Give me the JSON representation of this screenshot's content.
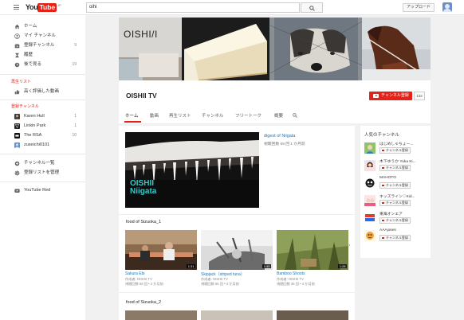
{
  "header": {
    "logo_you": "You",
    "logo_tube": "Tube",
    "logo_region": "JP",
    "search_value": "oihi",
    "upload_label": "アップロード"
  },
  "sidebar": {
    "nav": [
      {
        "label": "ホーム",
        "icon": "home-icon"
      },
      {
        "label": "マイ チャンネル",
        "icon": "person-icon"
      },
      {
        "label": "登録チャンネル",
        "icon": "subscriptions-icon",
        "count": "9"
      },
      {
        "label": "履歴",
        "icon": "hourglass-icon"
      },
      {
        "label": "後で見る",
        "icon": "clock-icon",
        "count": "19"
      }
    ],
    "playlists_heading": "再生リスト",
    "playlists": [
      {
        "label": "高く評価した動画",
        "icon": "thumbs-up-icon"
      }
    ],
    "subscriptions_heading": "登録チャンネル",
    "subscriptions": [
      {
        "label": "Karen Hull",
        "count": "1"
      },
      {
        "label": "Linkin Park",
        "count": "1"
      },
      {
        "label": "The RSA",
        "count": "10"
      },
      {
        "label": "zuseichi0101"
      }
    ],
    "browse_channels": "チャンネル一覧",
    "manage_subscriptions": "登録リストを管理",
    "youtube_red": "YouTube Red"
  },
  "channel": {
    "logo_text": "OISHI/I",
    "title": "OISHII TV",
    "subscribe_label": "チャンネル登録",
    "subscriber_count": "132",
    "tabs": [
      "ホーム",
      "動画",
      "再生リスト",
      "チャンネル",
      "フリートーク",
      "概要"
    ]
  },
  "featured": {
    "title": "digest of Niigata",
    "meta": "視聴回数 69 回 1 か月前",
    "overlay_line1": "OISHII",
    "overlay_line2": "Niigata"
  },
  "sections": [
    {
      "title": "food of Sizuoka_1",
      "videos": [
        {
          "title": "Sakura Ebi",
          "author": "作成者: OISHII TV",
          "meta": "視聴回数 69 回 • 4 か月前",
          "duration": "1:31"
        },
        {
          "title": "Skipjack（striped tuna）",
          "author": "作成者: OISHII TV",
          "meta": "視聴回数 65 回 • 4 か月前",
          "duration": "1:45"
        },
        {
          "title": "Bamboo Shoots",
          "author": "作成者: OISHII TV",
          "meta": "視聴回数 35 回 • 4 か月前",
          "duration": "1:28"
        }
      ]
    },
    {
      "title": "food of Sizuoka_2",
      "videos": []
    }
  ],
  "right_panel": {
    "title": "人気のチャンネル",
    "subscribe_label": "チャンネル登録",
    "channels": [
      {
        "name": "はじめしゃちょー..."
      },
      {
        "name": "木下ゆうか Yuka Ki..."
      },
      {
        "name": "MAHOTO"
      },
      {
        "name": "キッズライン♡Kid..."
      },
      {
        "name": "東海オンエア"
      },
      {
        "name": "AAAjoken"
      }
    ]
  },
  "colors": {
    "accent": "#e62117",
    "link": "#167ac6"
  }
}
